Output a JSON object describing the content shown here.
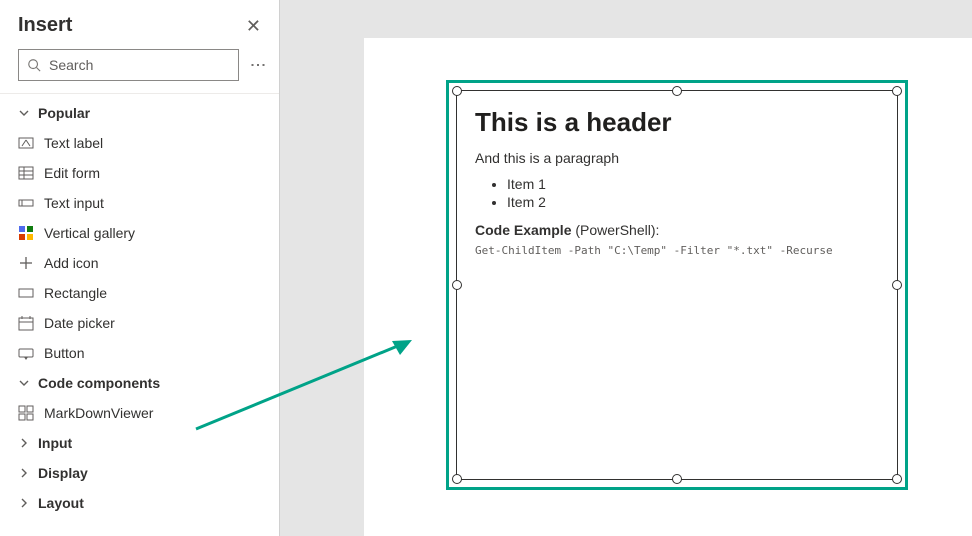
{
  "panel": {
    "title": "Insert",
    "search_placeholder": "Search"
  },
  "categories": {
    "popular": {
      "label": "Popular"
    },
    "code_components": {
      "label": "Code components"
    },
    "input": {
      "label": "Input"
    },
    "display": {
      "label": "Display"
    },
    "layout": {
      "label": "Layout"
    }
  },
  "items": {
    "text_label": "Text label",
    "edit_form": "Edit form",
    "text_input": "Text input",
    "vertical_gallery": "Vertical gallery",
    "add_icon": "Add icon",
    "rectangle": "Rectangle",
    "date_picker": "Date picker",
    "button": "Button",
    "markdown_viewer": "MarkDownViewer"
  },
  "preview": {
    "header": "This is a header",
    "paragraph": "And this is a paragraph",
    "list_item_1": "Item 1",
    "list_item_2": "Item 2",
    "code_label_bold": "Code Example",
    "code_label_rest": " (PowerShell):",
    "code": "Get-ChildItem -Path \"C:\\Temp\" -Filter \"*.txt\" -Recurse"
  }
}
